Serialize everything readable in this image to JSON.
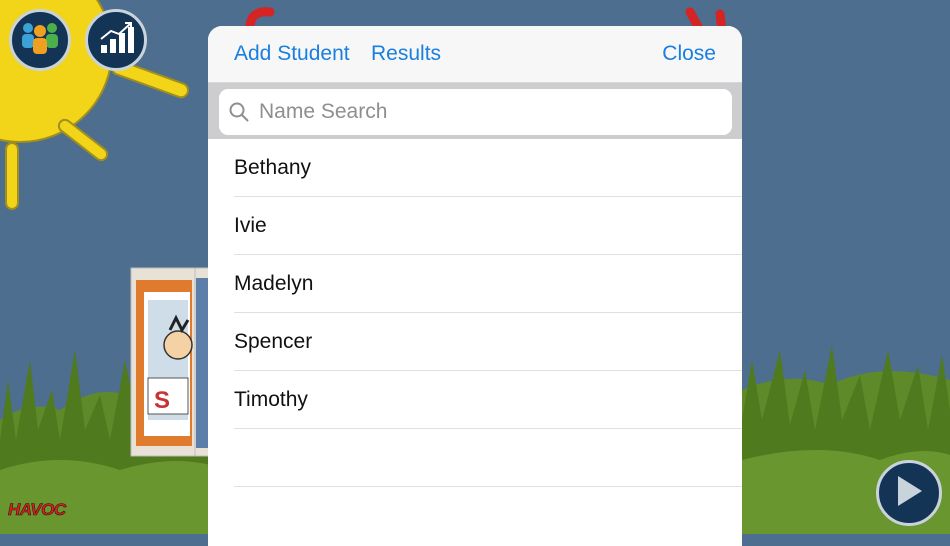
{
  "modal": {
    "add_student_label": "Add Student",
    "results_label": "Results",
    "close_label": "Close"
  },
  "search": {
    "placeholder": "Name Search",
    "value": ""
  },
  "students": [
    "Bethany",
    "Ivie",
    "Madelyn",
    "Spencer",
    "Timothy"
  ],
  "background": {
    "logo_text": "HAVOC"
  },
  "colors": {
    "accent": "#1a7fe0",
    "sky": "#4d6e8f",
    "sun": "#f2d418"
  },
  "icons": {
    "students_button": "students-group-icon",
    "results_button": "bar-chart-icon",
    "play_button": "play-icon",
    "search": "search-icon"
  }
}
